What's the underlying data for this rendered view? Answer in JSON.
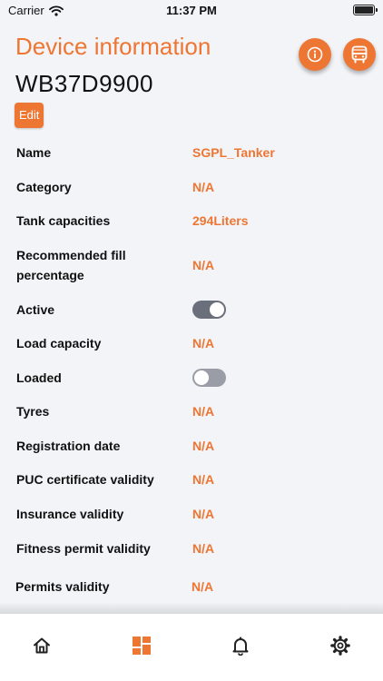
{
  "status_bar": {
    "carrier": "Carrier",
    "time": "11:37 PM"
  },
  "header": {
    "title": "Device information",
    "device_id": "WB37D9900",
    "edit_label": "Edit"
  },
  "fields": [
    {
      "label": "Name",
      "value": "SGPL_Tanker"
    },
    {
      "label": "Category",
      "value": "N/A"
    },
    {
      "label": "Tank capacities",
      "value": "294Liters"
    },
    {
      "label": "Recommended fill percentage",
      "value": "N/A"
    },
    {
      "label": "Active",
      "toggle": true
    },
    {
      "label": "Load capacity",
      "value": "N/A"
    },
    {
      "label": "Loaded",
      "toggle": false
    },
    {
      "label": "Tyres",
      "value": "N/A"
    },
    {
      "label": "Registration date",
      "value": "N/A"
    },
    {
      "label": "PUC certificate validity",
      "value": "N/A"
    },
    {
      "label": "Insurance validity",
      "value": "N/A"
    },
    {
      "label": "Fitness permit validity",
      "value": "N/A"
    },
    {
      "label": "Permits validity",
      "value": "N/A"
    }
  ],
  "fab_icons": [
    "info-icon",
    "bus-icon"
  ],
  "tabs": [
    {
      "icon": "home-icon",
      "active": false
    },
    {
      "icon": "dashboard-icon",
      "active": true
    },
    {
      "icon": "bell-icon",
      "active": false
    },
    {
      "icon": "settings-icon",
      "active": false
    }
  ],
  "colors": {
    "accent": "#ee7633",
    "background": "#f2f4f8",
    "toggle_on": "#6b6f7b",
    "toggle_off": "#9a9da6"
  }
}
